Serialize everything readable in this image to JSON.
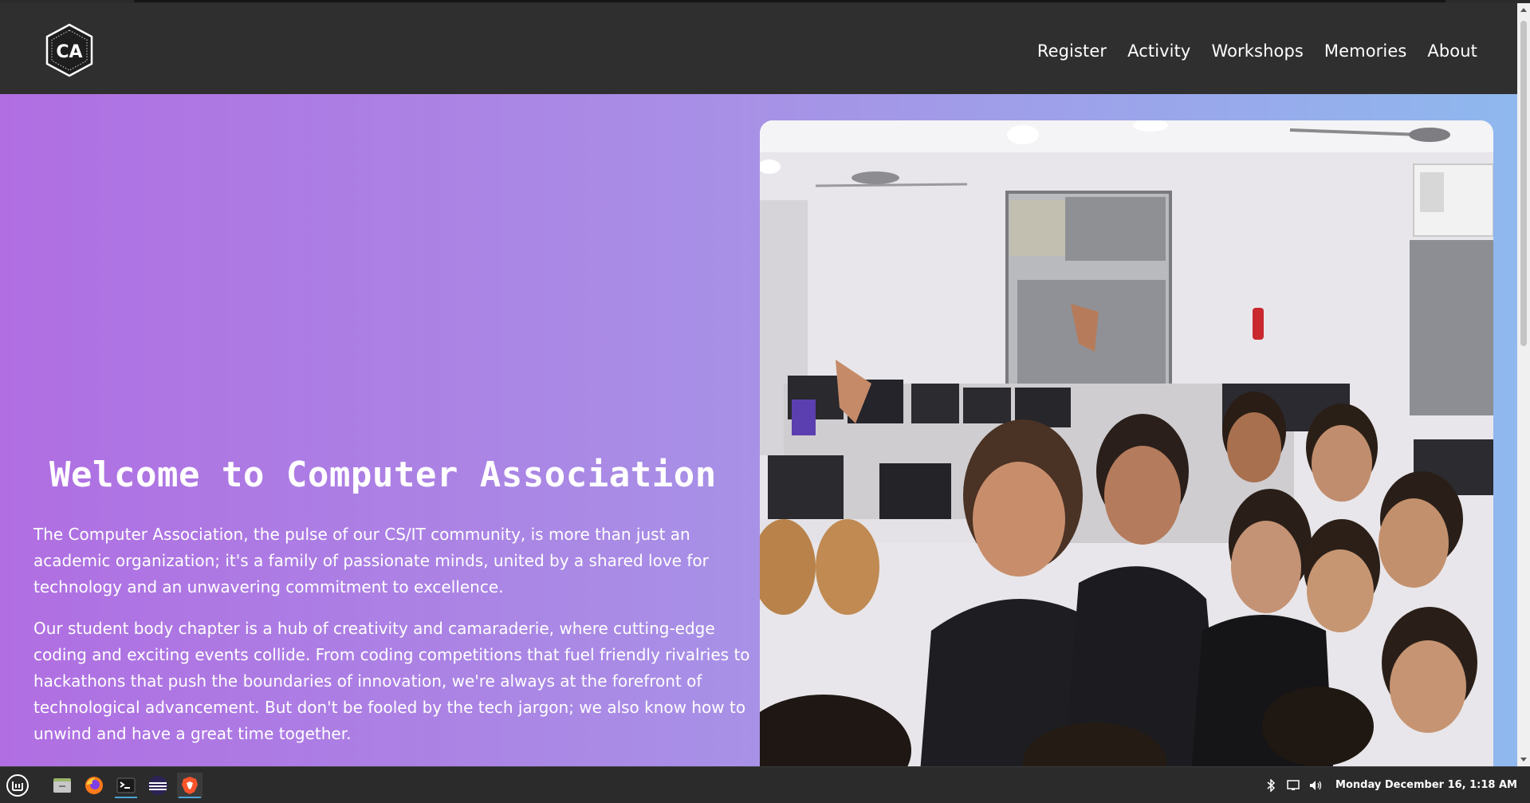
{
  "site": {
    "logo_text": "CA",
    "logo_ring_text": "COMPUTER ASSOCIATION"
  },
  "nav": {
    "items": [
      "Register",
      "Activity",
      "Workshops",
      "Memories",
      "About"
    ]
  },
  "hero": {
    "title": "Welcome to Computer Association",
    "paragraphs": [
      "The Computer Association, the pulse of our CS/IT community, is more than just an academic organization; it's a family of passionate minds, united by a shared love for technology and an unwavering commitment to excellence.",
      "Our student body chapter is a hub of creativity and camaraderie, where cutting-edge coding and exciting events collide. From coding competitions that fuel friendly rivalries to hackathons that push the boundaries of innovation, we're always at the forefront of technological advancement. But don't be fooled by the tech jargon; we also know how to unwind and have a great time together."
    ]
  },
  "taskbar": {
    "apps": [
      "mint-menu-icon",
      "file-manager-icon",
      "firefox-icon",
      "terminal-icon",
      "eclipse-icon",
      "brave-icon"
    ],
    "tray": [
      "bluetooth-icon",
      "display-icon",
      "volume-icon"
    ],
    "clock": "Monday December 16, 1:18 AM"
  },
  "colors": {
    "navbar": "#2f2f2f",
    "gradient_start": "#b06ee2",
    "gradient_end": "#8fb8ee",
    "taskbar": "#2b2b2b",
    "active_indicator": "#4da3d6"
  }
}
